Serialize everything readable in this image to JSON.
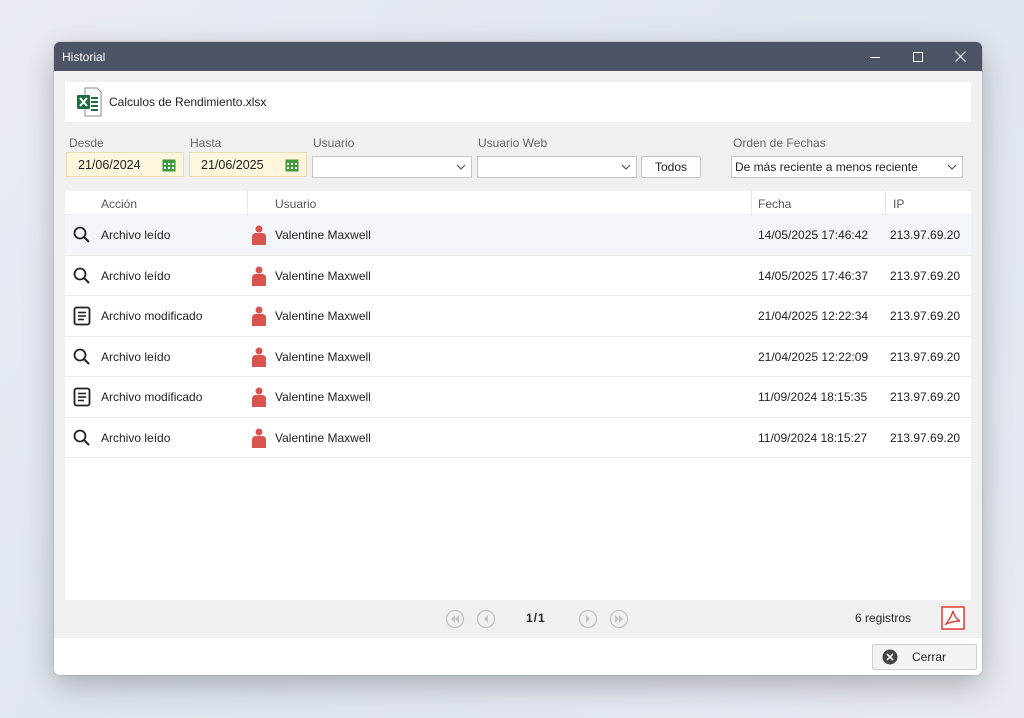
{
  "window": {
    "title": "Historial"
  },
  "file": {
    "name": "Calculos de Rendimiento.xlsx",
    "icon": "excel-file-icon"
  },
  "filters": {
    "desde": {
      "label": "Desde",
      "value": "21/06/2024"
    },
    "hasta": {
      "label": "Hasta",
      "value": "21/06/2025"
    },
    "usuario": {
      "label": "Usuario",
      "value": ""
    },
    "usuario_web": {
      "label": "Usuario Web",
      "value": ""
    },
    "todos_label": "Todos",
    "orden": {
      "label": "Orden de Fechas",
      "value": "De más reciente a menos reciente"
    }
  },
  "table": {
    "columns": [
      "Acción",
      "Usuario",
      "Fecha",
      "IP"
    ],
    "rows": [
      {
        "icon": "search-icon",
        "accion": "Archivo leído",
        "usuario": "Valentine Maxwell",
        "fecha": "14/05/2025 17:46:42",
        "ip": "213.97.69.20"
      },
      {
        "icon": "search-icon",
        "accion": "Archivo leído",
        "usuario": "Valentine Maxwell",
        "fecha": "14/05/2025 17:46:37",
        "ip": "213.97.69.20"
      },
      {
        "icon": "document-icon",
        "accion": "Archivo modificado",
        "usuario": "Valentine Maxwell",
        "fecha": "21/04/2025 12:22:34",
        "ip": "213.97.69.20"
      },
      {
        "icon": "search-icon",
        "accion": "Archivo leído",
        "usuario": "Valentine Maxwell",
        "fecha": "21/04/2025 12:22:09",
        "ip": "213.97.69.20"
      },
      {
        "icon": "document-icon",
        "accion": "Archivo modificado",
        "usuario": "Valentine Maxwell",
        "fecha": "11/09/2024 18:15:35",
        "ip": "213.97.69.20"
      },
      {
        "icon": "search-icon",
        "accion": "Archivo leído",
        "usuario": "Valentine Maxwell",
        "fecha": "11/09/2024 18:15:27",
        "ip": "213.97.69.20"
      }
    ]
  },
  "pager": {
    "page_text": "1/1",
    "records_text": "6 registros"
  },
  "footer": {
    "close_label": "Cerrar"
  },
  "colors": {
    "titlebar": "#4d5466",
    "user_icon": "#d9534f",
    "excel_green": "#1d6f42",
    "pdf_red": "#e03a2f",
    "date_field_bg": "#fdf6dc"
  }
}
